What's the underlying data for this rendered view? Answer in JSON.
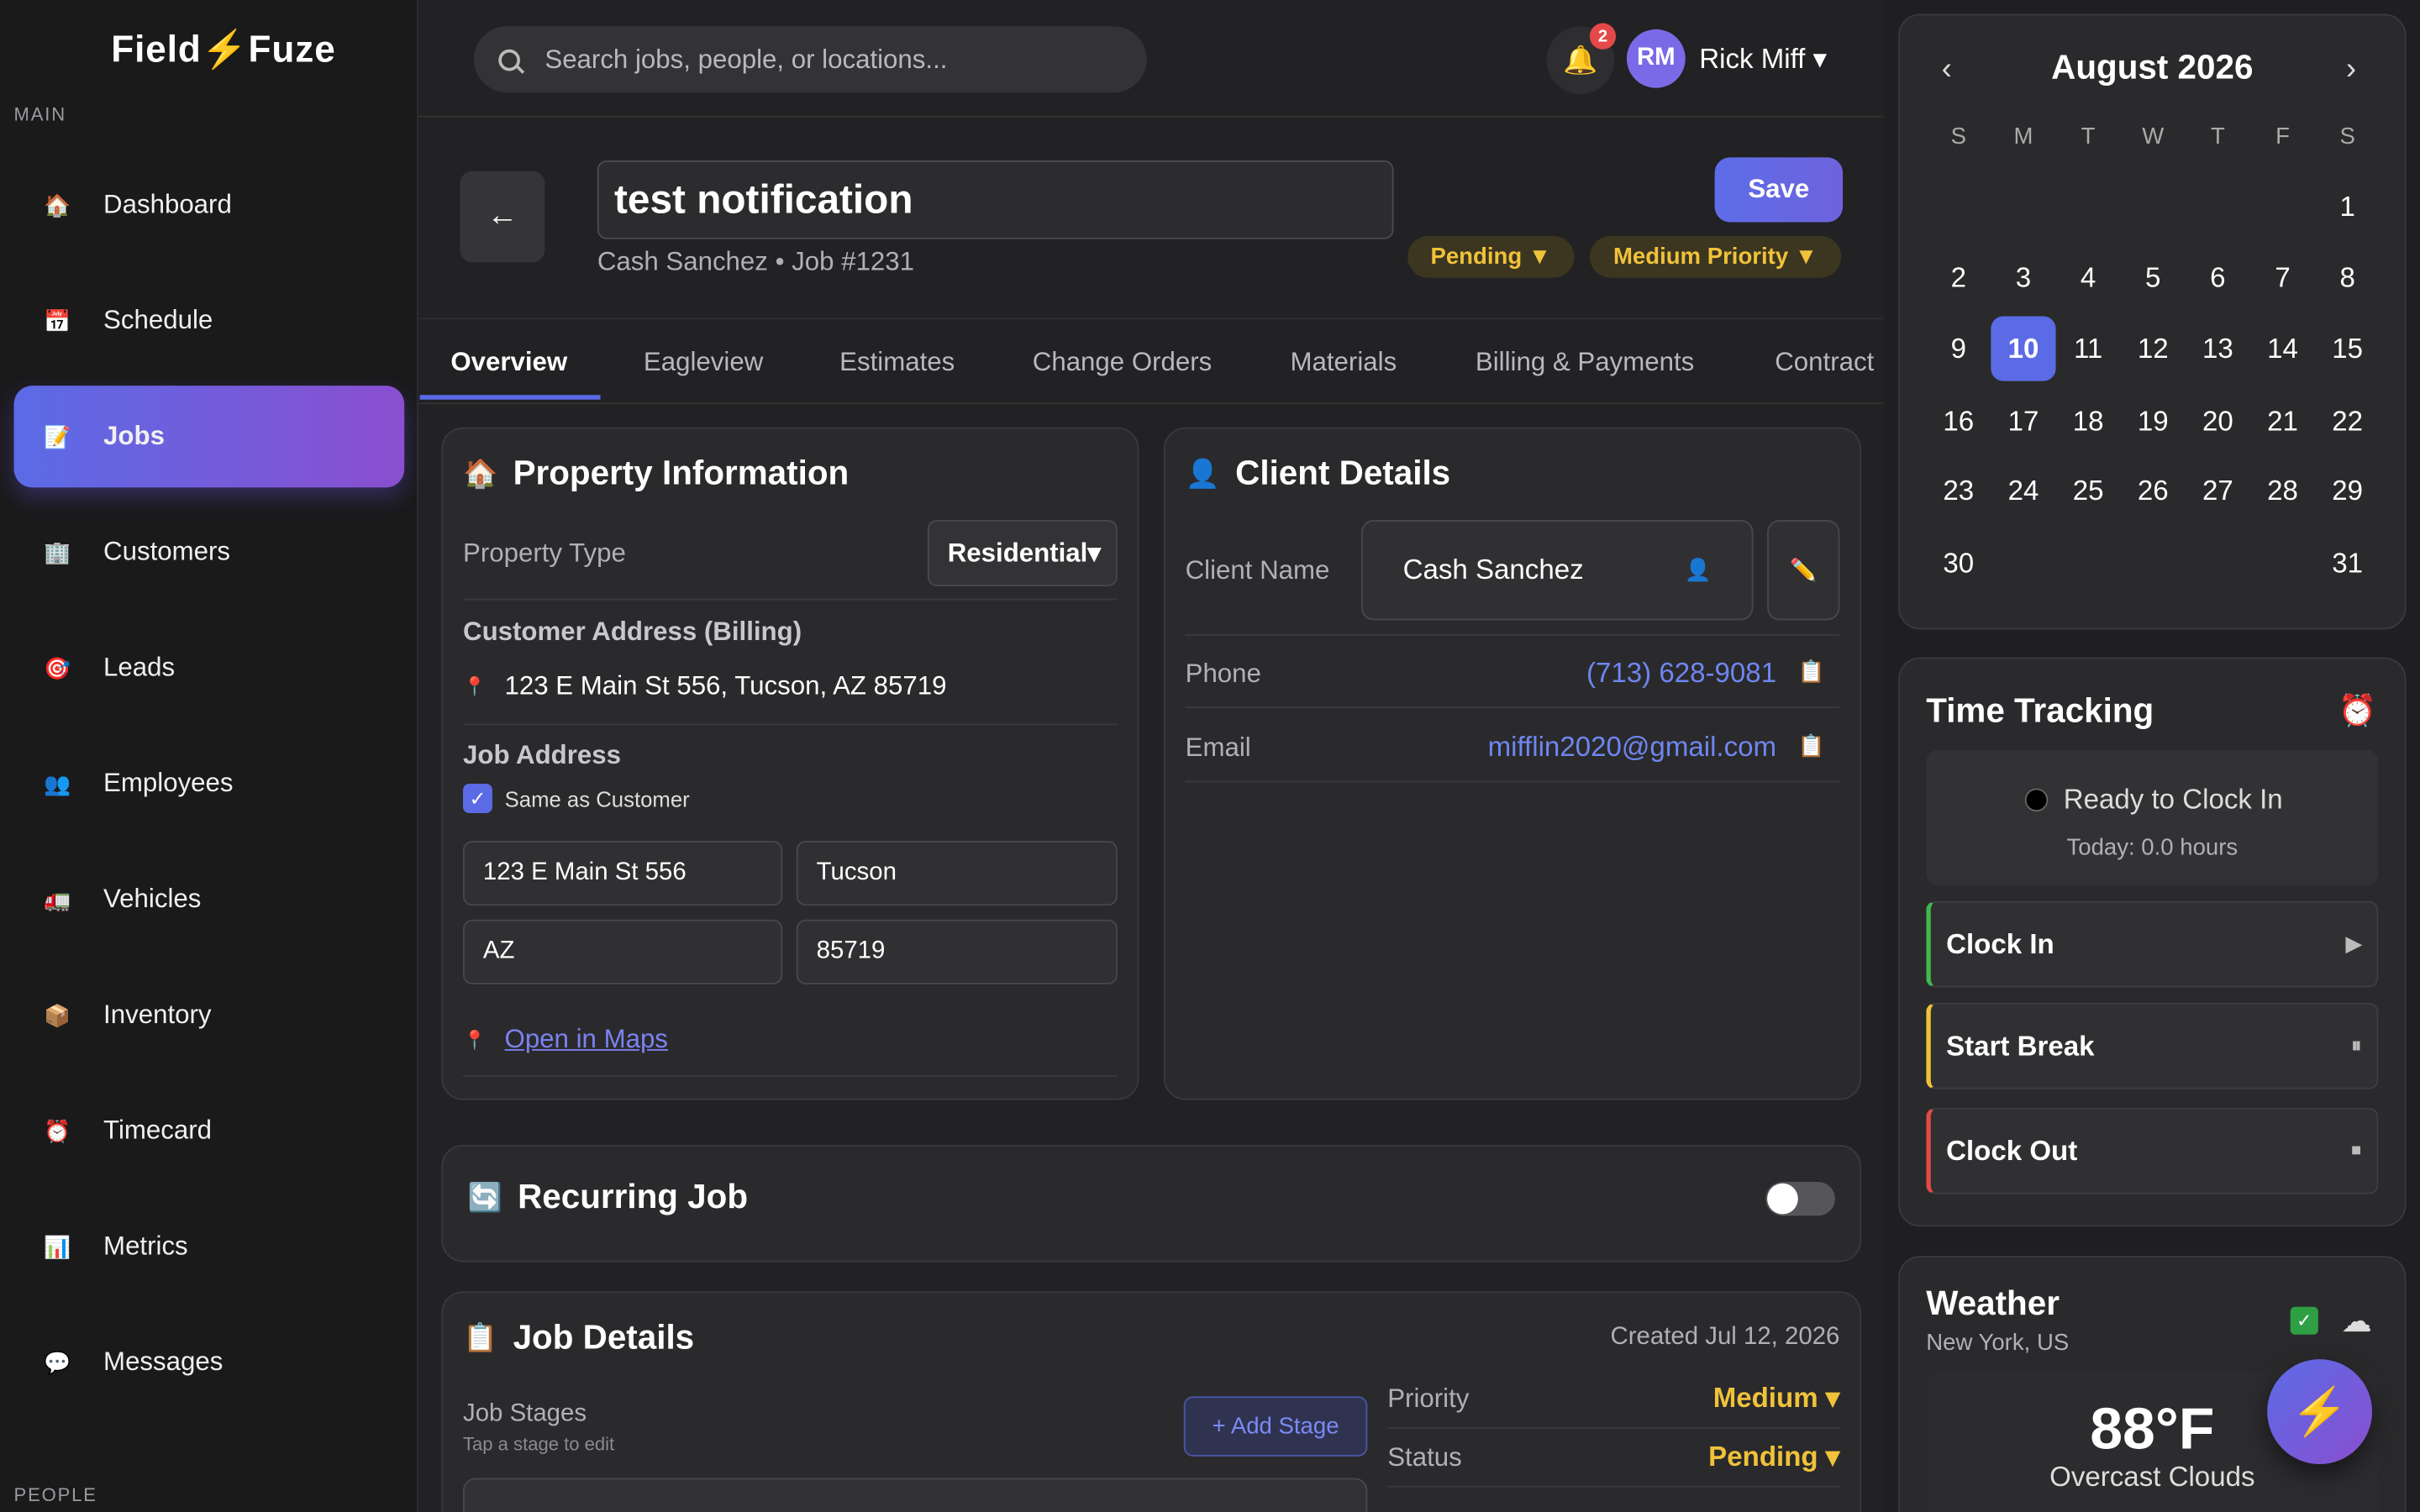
{
  "brand": {
    "logo_left": "Field",
    "logo_bolt": "⚡",
    "logo_right": "Fuze"
  },
  "sidebar": {
    "section_main": "MAIN",
    "section_people": "PEOPLE",
    "items": [
      {
        "label": "Dashboard",
        "icon": "🏠",
        "active": false
      },
      {
        "label": "Schedule",
        "icon": "📅",
        "active": false
      },
      {
        "label": "Jobs",
        "icon": "📝",
        "active": true
      },
      {
        "label": "Customers",
        "icon": "🏢",
        "active": false
      },
      {
        "label": "Leads",
        "icon": "🎯",
        "active": false
      },
      {
        "label": "Employees",
        "icon": "👥",
        "active": false
      },
      {
        "label": "Vehicles",
        "icon": "🚛",
        "active": false
      },
      {
        "label": "Inventory",
        "icon": "📦",
        "active": false
      },
      {
        "label": "Timecard",
        "icon": "⏰",
        "active": false
      },
      {
        "label": "Metrics",
        "icon": "📊",
        "active": false
      },
      {
        "label": "Messages",
        "icon": "💬",
        "active": false
      }
    ]
  },
  "header": {
    "search_placeholder": "Search jobs, people, or locations...",
    "notifications": "2",
    "avatar_initials": "RM",
    "user_name": "Rick Miff ▾"
  },
  "job": {
    "title": "test notification",
    "subtitle": "Cash Sanchez • Job #1231",
    "save_label": "Save",
    "status_pill": "Pending ▼",
    "priority_pill": "Medium Priority ▼"
  },
  "tabs": [
    "Overview",
    "Eagleview",
    "Estimates",
    "Change Orders",
    "Materials",
    "Billing & Payments",
    "Contract"
  ],
  "property": {
    "title": "Property Information",
    "type_label": "Property Type",
    "type_value": "Residential▾",
    "billing_label": "Customer Address (Billing)",
    "billing_address": "123 E Main St 556, Tucson, AZ 85719",
    "job_address_label": "Job Address",
    "same_as_customer": "Same as Customer",
    "street": "123 E Main St 556",
    "city": "Tucson",
    "state": "AZ",
    "zip": "85719",
    "maps_link": "Open in Maps"
  },
  "client": {
    "title": "Client Details",
    "name_label": "Client Name",
    "name_value": "Cash Sanchez",
    "phone_label": "Phone",
    "phone_value": "(713) 628-9081",
    "email_label": "Email",
    "email_value": "mifflin2020@gmail.com"
  },
  "recurring": {
    "title": "Recurring Job",
    "enabled": false
  },
  "job_details": {
    "title": "Job Details",
    "created": "Created Jul 12, 2026",
    "stages_label": "Job Stages",
    "stages_hint": "Tap a stage to edit",
    "add_stage": "+ Add Stage",
    "priority_label": "Priority",
    "priority_value": "Medium ▾",
    "status_label": "Status",
    "status_value": "Pending ▾"
  },
  "calendar": {
    "month": "August 2026",
    "dow": [
      "S",
      "M",
      "T",
      "W",
      "T",
      "F",
      "S"
    ],
    "today": "10",
    "weeks": [
      [
        "",
        "",
        "",
        "",
        "",
        "",
        "1"
      ],
      [
        "2",
        "3",
        "4",
        "5",
        "6",
        "7",
        "8"
      ],
      [
        "9",
        "10",
        "11",
        "12",
        "13",
        "14",
        "15"
      ],
      [
        "16",
        "17",
        "18",
        "19",
        "20",
        "21",
        "22"
      ],
      [
        "23",
        "24",
        "25",
        "26",
        "27",
        "28",
        "29"
      ],
      [
        "30",
        "",
        "",
        "",
        "",
        "",
        "31"
      ]
    ]
  },
  "time_tracking": {
    "title": "Time Tracking",
    "status": "Ready to Clock In",
    "today": "Today: 0.0 hours",
    "clock_in": "Clock In",
    "start_break": "Start Break",
    "clock_out": "Clock Out"
  },
  "weather": {
    "title": "Weather",
    "location": "New York, US",
    "temp": "88°F",
    "desc": "Overcast Clouds"
  },
  "colors": {
    "accent": "#5b6be6",
    "accent2": "#8a4fd0",
    "pending": "#f0c23a",
    "link": "#6f86f0"
  }
}
